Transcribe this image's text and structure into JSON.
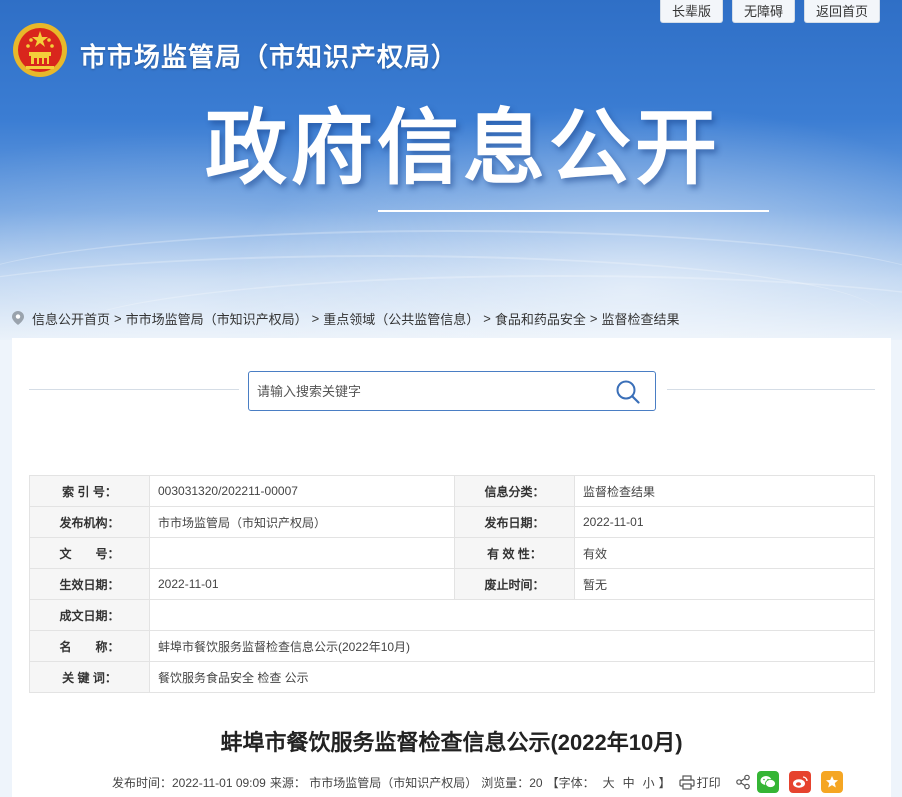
{
  "top_links": [
    "长辈版",
    "无障碍",
    "返回首页"
  ],
  "site_title": "市市场监管局（市知识产权局）",
  "hero_title": "政府信息公开",
  "breadcrumb": [
    "信息公开首页",
    "市市场监管局（市知识产权局）",
    "重点领域（公共监管信息）",
    "食品和药品安全",
    "监督检查结果"
  ],
  "breadcrumb_sep": ">",
  "search": {
    "placeholder": "请输入搜索关键字"
  },
  "info": {
    "index_label": "索 引 号：",
    "index_value": "003031320/202211-00007",
    "category_label": "信息分类：",
    "category_value": "监督检查结果",
    "publisher_label": "发布机构：",
    "publisher_value": "市市场监管局（市知识产权局）",
    "pubdate_label": "发布日期：",
    "pubdate_value": "2022-11-01",
    "docno_label": "文　　号：",
    "docno_value": "",
    "validity_label": "有 效 性：",
    "validity_value": "有效",
    "effective_label": "生效日期：",
    "effective_value": "2022-11-01",
    "abolish_label": "废止时间：",
    "abolish_value": "暂无",
    "created_label": "成文日期：",
    "created_value": "",
    "name_label": "名　　称：",
    "name_value": "蚌埠市餐饮服务监督检查信息公示(2022年10月)",
    "keywords_label": "关 键 词：",
    "keywords_value": "餐饮服务食品安全 检查 公示"
  },
  "article": {
    "title": "蚌埠市餐饮服务监督检查信息公示(2022年10月)",
    "meta_time": "发布时间：2022-11-01 09:09",
    "meta_source": "来源： 市市场监管局（市知识产权局）",
    "meta_views": "浏览量：20",
    "font_open": "【字体：",
    "font_large": "大",
    "font_medium": "中",
    "font_small": "小",
    "font_close": "】",
    "print": "打印"
  },
  "colors": {
    "banner_blue": "#2f6fc6",
    "wechat": "#35b535",
    "weibo": "#e6432e",
    "favorite": "#f5a623"
  }
}
